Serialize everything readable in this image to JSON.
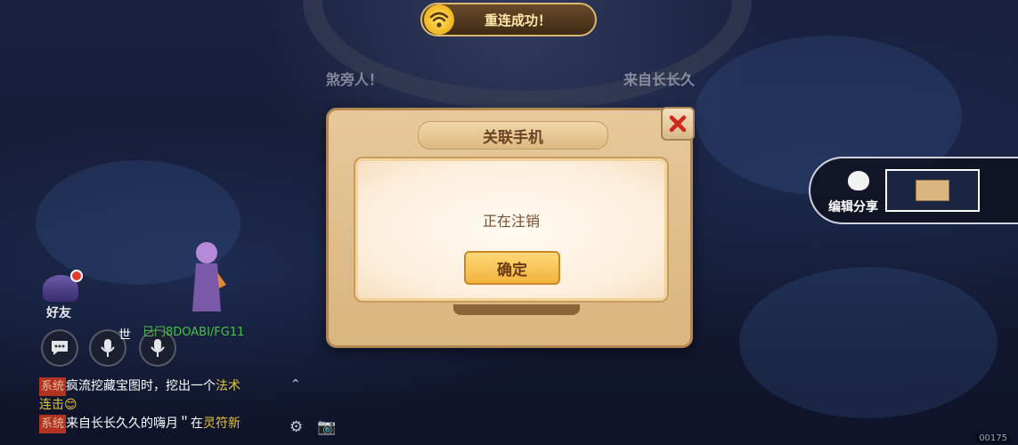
{
  "toast": {
    "icon": "wifi-icon",
    "message": "重连成功！"
  },
  "background": {
    "left_text": "煞旁人！",
    "right_text": "来自长长久"
  },
  "dialog": {
    "title": "关联手机",
    "status": "正在注销",
    "confirm_label": "确定"
  },
  "share": {
    "label": "编辑分享"
  },
  "hud": {
    "friends_label": "好友",
    "world_label": "世",
    "player_name": "已门8DOABI/FG11",
    "chat": [
      {
        "tag": "系统",
        "text": "疯流挖藏宝图时，挖出一个",
        "highlight": "法术",
        "tail": "连击😊"
      },
      {
        "tag": "系统",
        "text": "来自长长久久的嗨月＂在",
        "highlight": "灵符新",
        "tail": ""
      }
    ],
    "corner_text": "00175"
  },
  "colors": {
    "accent_gold": "#f2b33d",
    "chat_tag": "#b0341f",
    "player_name": "#47c04a"
  }
}
